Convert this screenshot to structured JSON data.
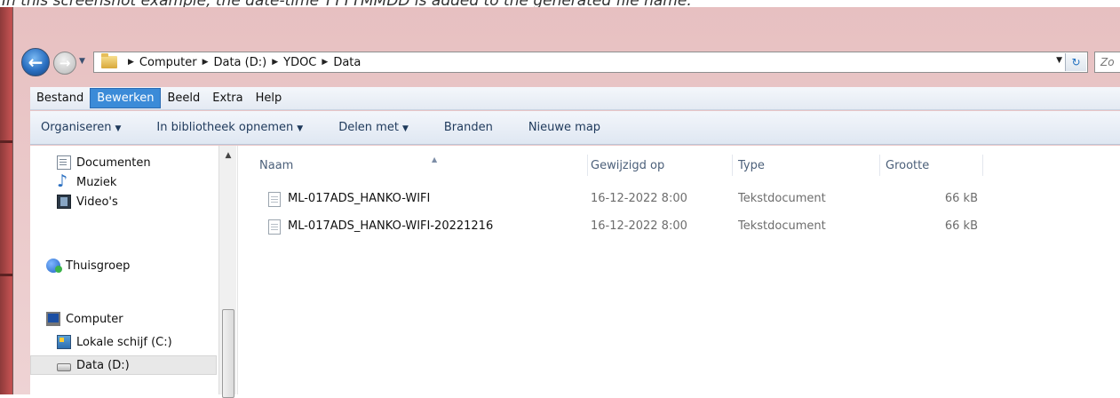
{
  "caption": "In this screenshot example, the date-time YYYYMMDD is added to the generated file name.",
  "address": {
    "crumbs": [
      "Computer",
      "Data (D:)",
      "YDOC",
      "Data"
    ],
    "search_placeholder": "Zo"
  },
  "menu": [
    "Bestand",
    "Bewerken",
    "Beeld",
    "Extra",
    "Help"
  ],
  "toolbar": {
    "organize": "Organiseren",
    "library": "In bibliotheek opnemen",
    "share": "Delen met",
    "burn": "Branden",
    "new_folder": "Nieuwe map"
  },
  "nav": {
    "documents": "Documenten",
    "music": "Muziek",
    "videos": "Video's",
    "homegroup": "Thuisgroep",
    "computer": "Computer",
    "local_c": "Lokale schijf (C:)",
    "data_d": "Data (D:)"
  },
  "columns": {
    "name": "Naam",
    "modified": "Gewijzigd op",
    "type": "Type",
    "size": "Grootte"
  },
  "files": [
    {
      "name": "ML-017ADS_HANKO-WIFI",
      "modified": "16-12-2022 8:00",
      "type": "Tekstdocument",
      "size": "66 kB"
    },
    {
      "name": "ML-017ADS_HANKO-WIFI-20221216",
      "modified": "16-12-2022 8:00",
      "type": "Tekstdocument",
      "size": "66 kB"
    }
  ],
  "colors": {
    "menu_active": "#3b8bd8",
    "frame": "#e7c0c1"
  }
}
